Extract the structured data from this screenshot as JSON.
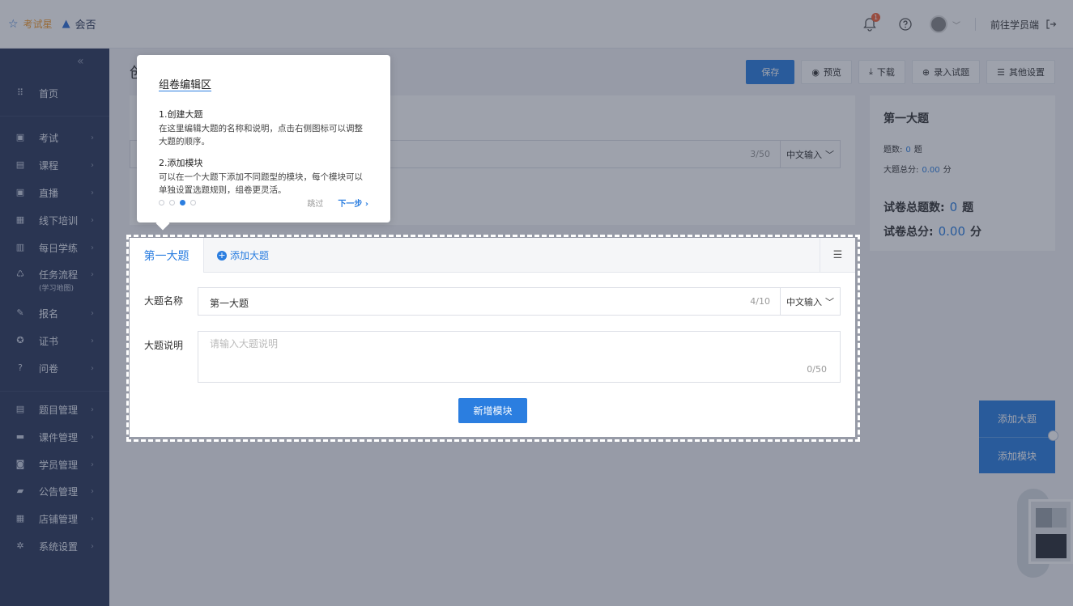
{
  "header": {
    "brand_primary": "考试星",
    "brand_secondary": "会否",
    "notification_count": "1",
    "to_student": "前往学员端"
  },
  "sidebar": {
    "items": [
      {
        "label": "首页",
        "icon": "grid-icon"
      },
      {
        "label": "考试",
        "icon": "exam-icon"
      },
      {
        "label": "课程",
        "icon": "book-icon"
      },
      {
        "label": "直播",
        "icon": "live-icon"
      },
      {
        "label": "线下培训",
        "icon": "training-icon"
      },
      {
        "label": "每日学练",
        "icon": "calendar-icon"
      },
      {
        "label": "任务流程",
        "icon": "flow-icon",
        "sub": "(学习地图)"
      },
      {
        "label": "报名",
        "icon": "signup-icon"
      },
      {
        "label": "证书",
        "icon": "certificate-icon"
      },
      {
        "label": "问卷",
        "icon": "survey-icon"
      },
      {
        "label": "题目管理",
        "icon": "question-bank-icon"
      },
      {
        "label": "课件管理",
        "icon": "folder-icon"
      },
      {
        "label": "学员管理",
        "icon": "student-icon"
      },
      {
        "label": "公告管理",
        "icon": "notice-icon"
      },
      {
        "label": "店铺管理",
        "icon": "shop-icon"
      },
      {
        "label": "系统设置",
        "icon": "gear-icon"
      }
    ]
  },
  "page": {
    "title_partial": "创"
  },
  "toolbar": {
    "save": "保存",
    "preview": "预览",
    "download": "下载",
    "import": "录入试题",
    "other": "其他设置"
  },
  "top_card": {
    "counter": "3/50",
    "ime": "中文输入"
  },
  "summary": {
    "title": "第一大题",
    "count_label": "题数:",
    "count_value": "0",
    "count_unit": "题",
    "score_label": "大题总分:",
    "score_value": "0.00",
    "score_unit": "分",
    "total_count_label": "试卷总题数:",
    "total_count_value": "0",
    "total_count_unit": "题",
    "total_score_label": "试卷总分:",
    "total_score_value": "0.00",
    "total_score_unit": "分"
  },
  "section": {
    "active_tab": "第一大题",
    "add_tab": "添加大题",
    "name_label": "大题名称",
    "name_value": "第一大题",
    "name_counter": "4/10",
    "ime": "中文输入",
    "desc_label": "大题说明",
    "desc_placeholder": "请输入大题说明",
    "desc_counter": "0/50",
    "add_module": "新增模块"
  },
  "float": {
    "add_section": "添加大题",
    "add_module": "添加模块"
  },
  "guide": {
    "title": "组卷编辑区",
    "step1_title": "1.创建大题",
    "step1_text": "在这里编辑大题的名称和说明，点击右侧图标可以调整大题的顺序。",
    "step2_title": "2.添加模块",
    "step2_text": "可以在一个大题下添加不同题型的模块，每个模块可以单独设置选题规则，组卷更灵活。",
    "step_current": 3,
    "step_total": 4,
    "skip": "跳过",
    "next": "下一步"
  },
  "colors": {
    "primary": "#2b7ee0",
    "sidebar": "#2d3a5c"
  }
}
